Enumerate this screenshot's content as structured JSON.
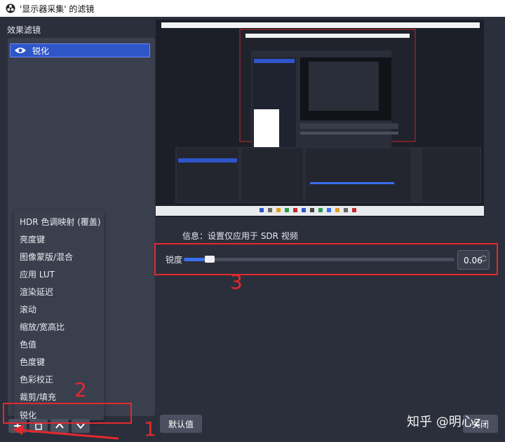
{
  "window": {
    "title": "'显示器采集' 的滤镜"
  },
  "left_panel": {
    "title": "效果滤镜",
    "filters": [
      {
        "label": "锐化"
      }
    ]
  },
  "add_menu": {
    "items": [
      {
        "label": "HDR 色调映射 (覆盖)"
      },
      {
        "label": "亮度键"
      },
      {
        "label": "图像蒙版/混合"
      },
      {
        "label": "应用 LUT"
      },
      {
        "label": "渲染延迟"
      },
      {
        "label": "滚动"
      },
      {
        "label": "缩放/宽高比"
      },
      {
        "label": "色值"
      },
      {
        "label": "色度键"
      },
      {
        "label": "色彩校正"
      },
      {
        "label": "裁剪/填充"
      },
      {
        "label": "锐化"
      }
    ]
  },
  "settings": {
    "info": "信息：设置仅应用于 SDR 视频",
    "sharpness": {
      "label": "锐度",
      "value": "0.06",
      "fraction": 0.06
    }
  },
  "buttons": {
    "defaults": "默认值",
    "close": "关闭"
  },
  "annotations": {
    "n1": "1",
    "n2": "2",
    "n3": "3"
  },
  "watermark": "知乎 @明心z",
  "colors": {
    "accent": "#2e56c8",
    "annotation_red": "#e4282e",
    "background": "#2b2f3b"
  }
}
